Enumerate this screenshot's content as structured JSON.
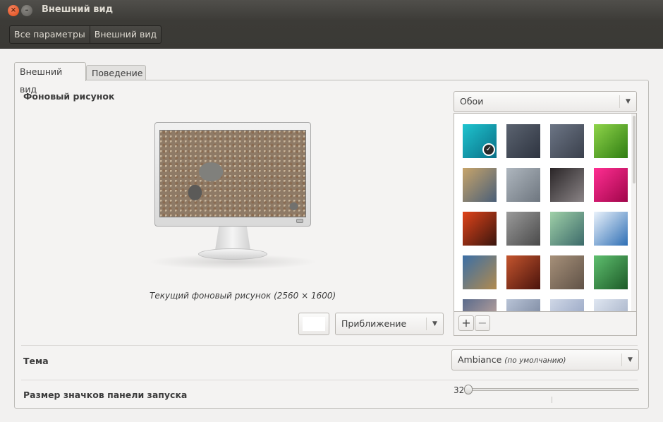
{
  "window": {
    "title": "Внешний вид"
  },
  "breadcrumbs": [
    "Все параметры",
    "Внешний вид"
  ],
  "tabs": [
    {
      "label": "Внешний вид",
      "active": true
    },
    {
      "label": "Поведение",
      "active": false
    }
  ],
  "background": {
    "section_label": "Фоновый рисунок",
    "source_select": "Обои",
    "caption": "Текущий фоновый рисунок (2560 × 1600)",
    "mode_select": "Приближение",
    "color": "#ffffff",
    "selected_index": 0
  },
  "gallery": {
    "thumbnails": [
      {
        "name": "teal-gradient",
        "colors": [
          "#1fc4cf",
          "#0a6f86"
        ]
      },
      {
        "name": "dark-spiral",
        "colors": [
          "#5b6370",
          "#2e3440"
        ]
      },
      {
        "name": "blue-grey-splash",
        "colors": [
          "#6c7585",
          "#3a404c"
        ]
      },
      {
        "name": "green-leaf",
        "colors": [
          "#8fd44a",
          "#2f7d12"
        ]
      },
      {
        "name": "grass-stems",
        "colors": [
          "#c7a46a",
          "#4a5f78"
        ]
      },
      {
        "name": "water-drops",
        "colors": [
          "#aeb6be",
          "#6e767f"
        ]
      },
      {
        "name": "dark-plant",
        "colors": [
          "#2a2527",
          "#8a8486"
        ]
      },
      {
        "name": "magenta-fabric",
        "colors": [
          "#ff2e92",
          "#a0064a"
        ]
      },
      {
        "name": "red-berries",
        "colors": [
          "#e0431a",
          "#3a160e"
        ]
      },
      {
        "name": "grey-stones",
        "colors": [
          "#9a9a9a",
          "#4a4a4a"
        ]
      },
      {
        "name": "green-glow",
        "colors": [
          "#9fd0a8",
          "#3c6a6a"
        ]
      },
      {
        "name": "blue-sky",
        "colors": [
          "#eaf2fb",
          "#2f6fb5"
        ]
      },
      {
        "name": "road-clouds",
        "colors": [
          "#3b6fa6",
          "#b18a4e"
        ]
      },
      {
        "name": "canyon",
        "colors": [
          "#c4552e",
          "#4a130c"
        ]
      },
      {
        "name": "pebbles",
        "colors": [
          "#a69079",
          "#605247"
        ]
      },
      {
        "name": "green-radial",
        "colors": [
          "#5fbf6f",
          "#1c5a27"
        ]
      },
      {
        "name": "dusk-lake",
        "colors": [
          "#5a6b8c",
          "#d4b0a0"
        ]
      },
      {
        "name": "grey-landscape",
        "colors": [
          "#b8c3d6",
          "#6d7a93"
        ]
      },
      {
        "name": "blue-haze",
        "colors": [
          "#cfd7e6",
          "#8a9abc"
        ]
      },
      {
        "name": "pale-sky",
        "colors": [
          "#dfe6f1",
          "#9aa7bf"
        ]
      }
    ],
    "add_label": "+",
    "remove_label": "−"
  },
  "theme": {
    "label": "Тема",
    "value": "Ambiance",
    "value_hint": "(по умолчанию)"
  },
  "launcher": {
    "label": "Размер значков панели запуска",
    "value": "32",
    "level_fraction": 0.0
  }
}
